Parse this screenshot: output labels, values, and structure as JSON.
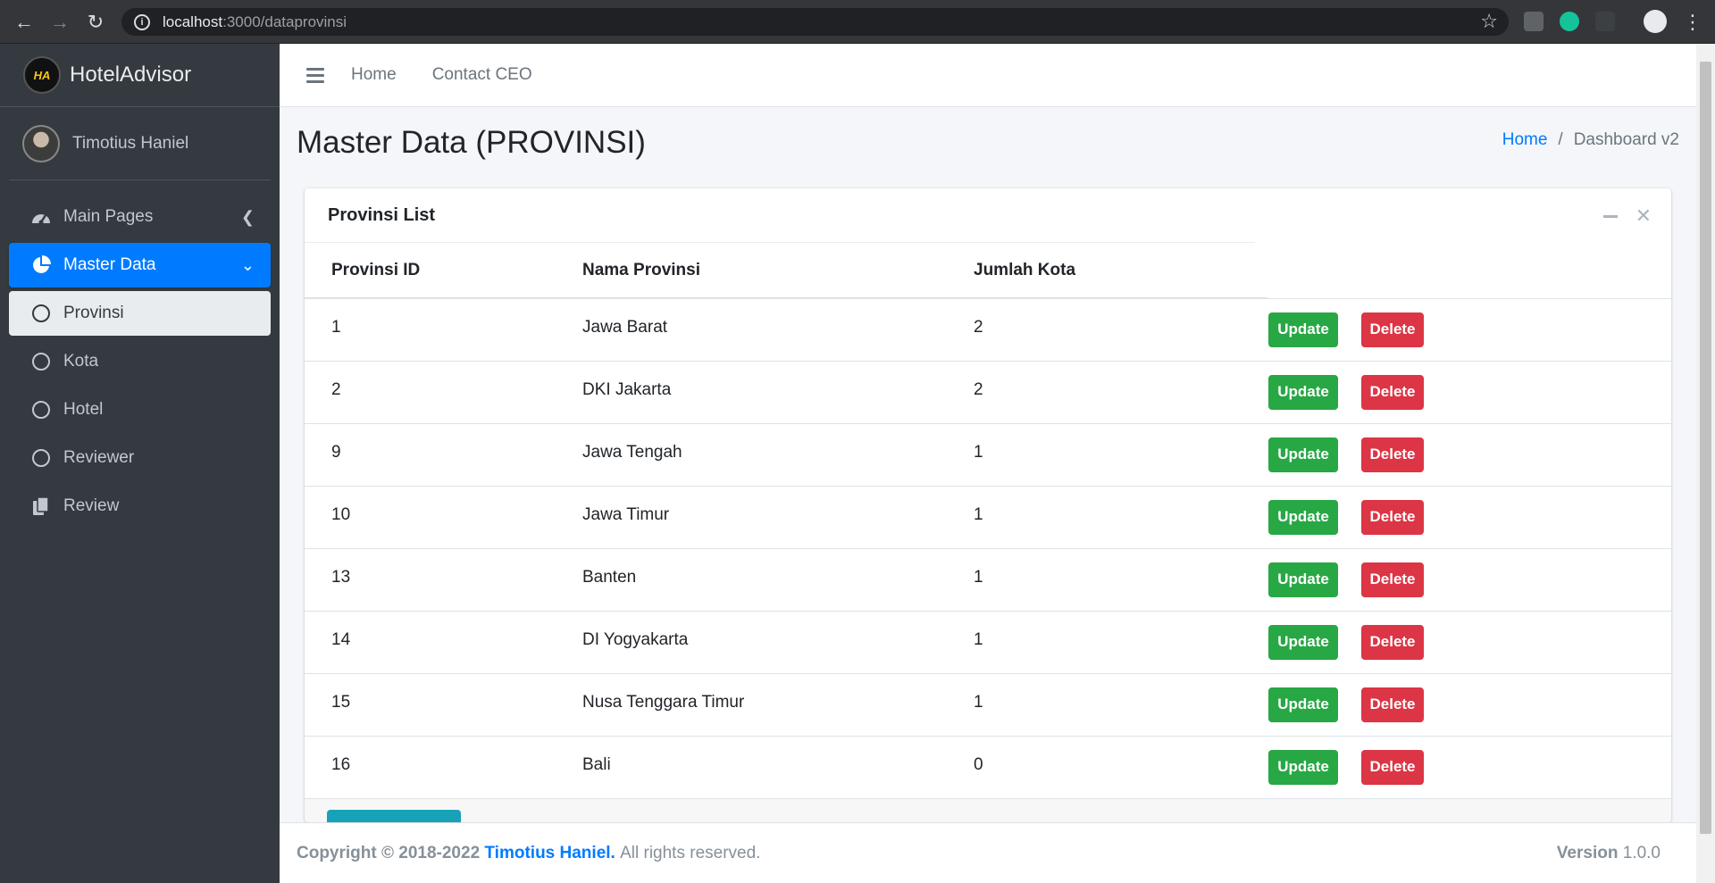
{
  "browser": {
    "url_host": "localhost",
    "url_rest": ":3000/dataprovinsi"
  },
  "brand": {
    "name": "HotelAdvisor",
    "logo_text": "HA"
  },
  "user": {
    "name": "Timotius Haniel"
  },
  "sidebar": {
    "items": [
      {
        "label": "Main Pages",
        "icon": "tachometer-icon"
      },
      {
        "label": "Master Data",
        "icon": "pie-chart-icon"
      },
      {
        "label": "Provinsi",
        "icon": "circle-icon"
      },
      {
        "label": "Kota",
        "icon": "circle-icon"
      },
      {
        "label": "Hotel",
        "icon": "circle-icon"
      },
      {
        "label": "Reviewer",
        "icon": "circle-icon"
      },
      {
        "label": "Review",
        "icon": "copy-icon"
      }
    ]
  },
  "topnav": {
    "home": "Home",
    "contact": "Contact CEO"
  },
  "page": {
    "title": "Master Data (PROVINSI)"
  },
  "breadcrumb": {
    "home": "Home",
    "sep": "/",
    "current": "Dashboard v2"
  },
  "card": {
    "title": "Provinsi List",
    "columns": [
      "Provinsi ID",
      "Nama Provinsi",
      "Jumlah Kota"
    ],
    "update_label": "Update",
    "delete_label": "Delete",
    "rows": [
      {
        "id": "1",
        "nama": "Jawa Barat",
        "jumlah": "2"
      },
      {
        "id": "2",
        "nama": "DKI Jakarta",
        "jumlah": "2"
      },
      {
        "id": "9",
        "nama": "Jawa Tengah",
        "jumlah": "1"
      },
      {
        "id": "10",
        "nama": "Jawa Timur",
        "jumlah": "1"
      },
      {
        "id": "13",
        "nama": "Banten",
        "jumlah": "1"
      },
      {
        "id": "14",
        "nama": "DI Yogyakarta",
        "jumlah": "1"
      },
      {
        "id": "15",
        "nama": "Nusa Tenggara Timur",
        "jumlah": "1"
      },
      {
        "id": "16",
        "nama": "Bali",
        "jumlah": "0"
      }
    ]
  },
  "footer": {
    "copyright": "Copyright © 2018-2022",
    "author": "Timotius Haniel.",
    "rights": "All rights reserved.",
    "version_label": "Version",
    "version": "1.0.0"
  },
  "colors": {
    "primary": "#007bff",
    "success": "#28a745",
    "danger": "#dc3545",
    "sidebar": "#343a40",
    "info": "#17a2b8"
  }
}
